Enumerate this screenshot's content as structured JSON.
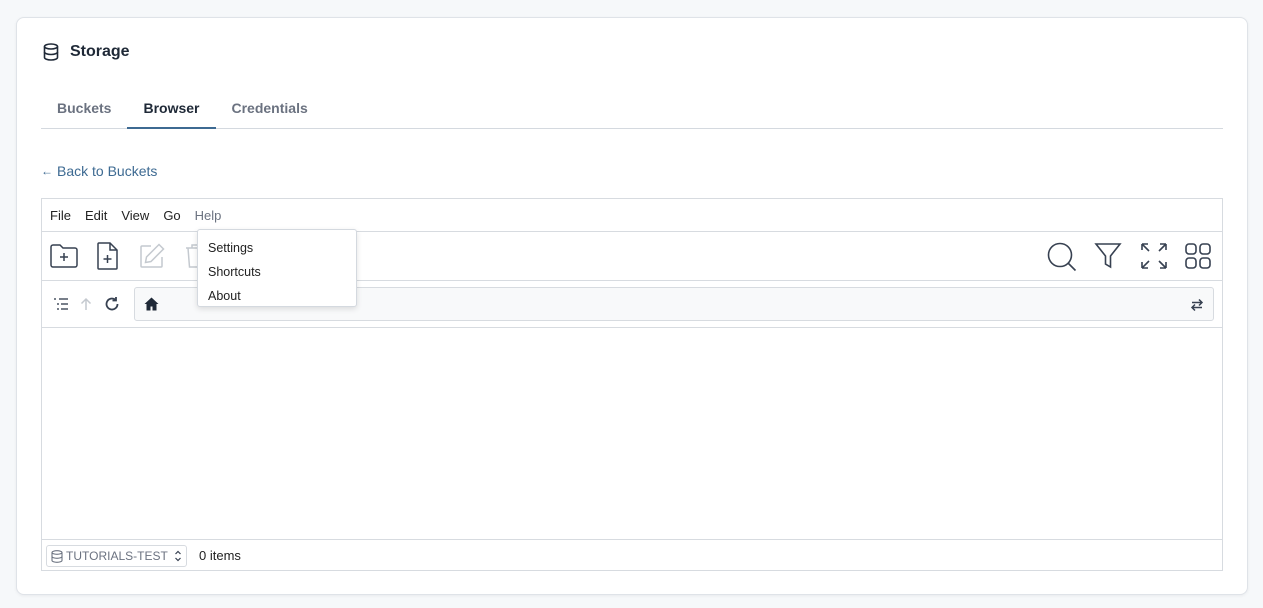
{
  "header": {
    "title": "Storage",
    "icon": "database-icon"
  },
  "tabs": [
    {
      "label": "Buckets",
      "active": false
    },
    {
      "label": "Browser",
      "active": true
    },
    {
      "label": "Credentials",
      "active": false
    }
  ],
  "back_link": {
    "arrow": "←",
    "label": "Back to Buckets"
  },
  "menubar": {
    "file": "File",
    "edit": "Edit",
    "view": "View",
    "go": "Go",
    "help": "Help"
  },
  "help_menu": {
    "settings": "Settings",
    "shortcuts": "Shortcuts",
    "about": "About"
  },
  "toolbar": {
    "left": [
      "new-folder-icon",
      "new-file-icon",
      "rename-icon",
      "delete-icon"
    ],
    "right": [
      "search-icon",
      "filter-icon",
      "fullscreen-icon",
      "grid-view-icon"
    ]
  },
  "path": {
    "icon": "home-icon",
    "value": ""
  },
  "status": {
    "bucket": "TUTORIALS-TEST",
    "items": "0 items"
  },
  "colors": {
    "accent": "#3d6a92",
    "border": "#d7dbe0",
    "muted": "#6b7280"
  }
}
